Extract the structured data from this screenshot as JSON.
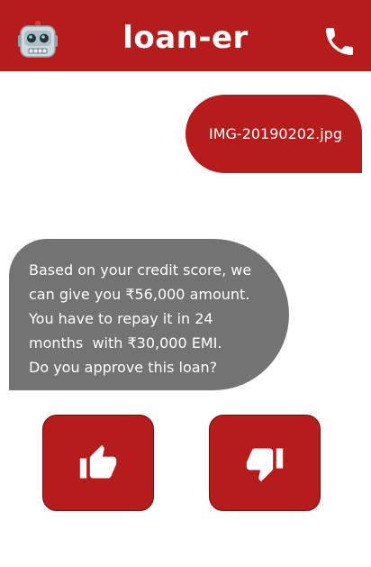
{
  "header": {
    "title": "loan-er",
    "avatar_icon": "robot-face-icon",
    "call_icon": "phone-icon",
    "color": "#b71c1c"
  },
  "messages": {
    "user": {
      "text": "IMG-20190202.jpg"
    },
    "bot": {
      "lines": [
        "Based on your credit score, we",
        "can give you ₹56,000 amount.",
        "You have to repay it in 24",
        "months  with ₹30,000 EMI.",
        "Do you approve this loan?"
      ]
    }
  },
  "actions": {
    "approve_icon": "thumbs-up-icon",
    "reject_icon": "thumbs-down-icon"
  },
  "colors": {
    "accent": "#b71c1c",
    "bot_bubble": "#737373",
    "background": "#ffffff"
  }
}
